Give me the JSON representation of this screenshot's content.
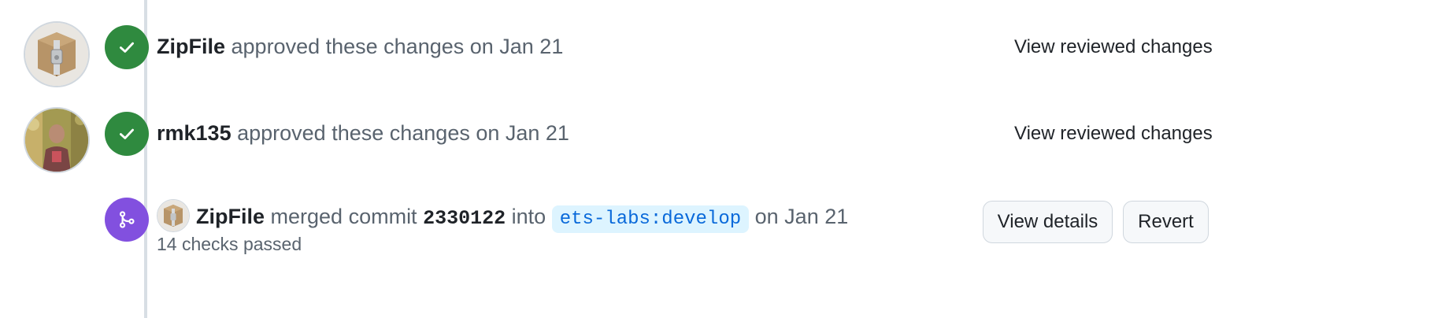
{
  "events": [
    {
      "actor": "ZipFile",
      "action": "approved these changes on Jan 21",
      "link_label": "View reviewed changes",
      "avatar": "zip-archive-avatar",
      "status_icon": "check-icon",
      "status_color": "#2f8a3f"
    },
    {
      "actor": "rmk135",
      "action": "approved these changes on Jan 21",
      "link_label": "View reviewed changes",
      "avatar": "person-photo-avatar",
      "status_icon": "check-icon",
      "status_color": "#2f8a3f"
    }
  ],
  "merge": {
    "actor": "ZipFile",
    "verb": "merged commit",
    "sha": "2330122",
    "into": "into",
    "branch": "ets-labs:develop",
    "date": "on Jan 21",
    "checks": "14 checks passed",
    "details_label": "View details",
    "revert_label": "Revert",
    "status_icon": "git-merge-icon",
    "status_color": "#8250df"
  },
  "colors": {
    "link": "#0969da",
    "branch_bg": "#ddf4ff",
    "muted_text": "#59636e",
    "timeline": "#d8dee4"
  }
}
